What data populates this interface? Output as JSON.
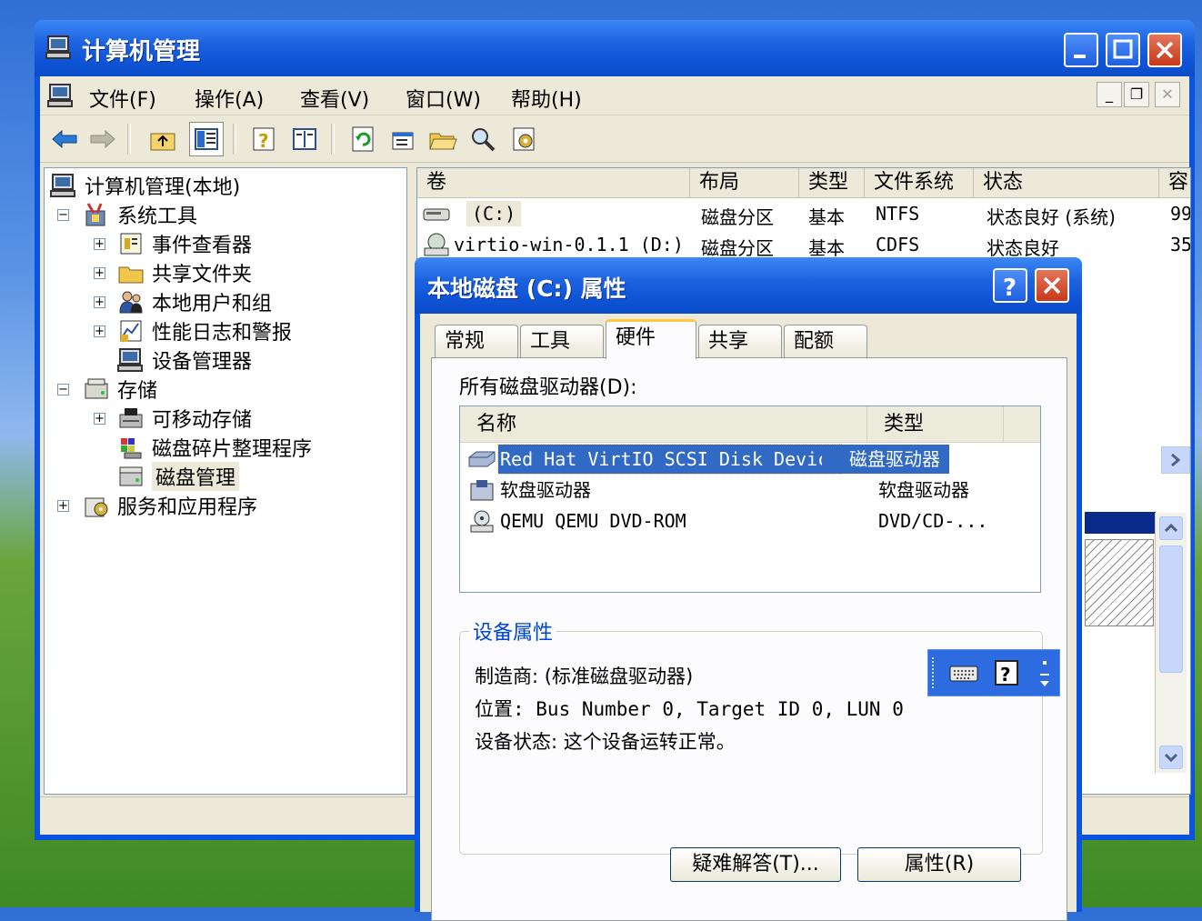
{
  "main_window": {
    "title": "计算机管理",
    "menu": [
      "文件(F)",
      "操作(A)",
      "查看(V)",
      "窗口(W)",
      "帮助(H)"
    ],
    "mdi_buttons": [
      "_",
      "❐",
      "✕"
    ]
  },
  "tree": {
    "root": "计算机管理(本地)",
    "system_tools": "系统工具",
    "event_viewer": "事件查看器",
    "shared_folders": "共享文件夹",
    "local_users": "本地用户和组",
    "perf_logs": "性能日志和警报",
    "device_manager": "设备管理器",
    "storage": "存储",
    "removable_storage": "可移动存储",
    "defrag": "磁盘碎片整理程序",
    "disk_management": "磁盘管理",
    "services_apps": "服务和应用程序"
  },
  "volume_list": {
    "columns": [
      "卷",
      "布局",
      "类型",
      "文件系统",
      "状态",
      "容"
    ],
    "rows": [
      {
        "volume": "(C:)",
        "layout": "磁盘分区",
        "type": "基本",
        "fs": "NTFS",
        "status": "状态良好 (系统)",
        "cap": "99"
      },
      {
        "volume": "virtio-win-0.1.1 (D:)",
        "layout": "磁盘分区",
        "type": "基本",
        "fs": "CDFS",
        "status": "状态良好",
        "cap": "35"
      }
    ]
  },
  "dialog": {
    "title": "本地磁盘 (C:) 属性",
    "tabs": [
      "常规",
      "工具",
      "硬件",
      "共享",
      "配额"
    ],
    "active_tab": "硬件",
    "list_label": "所有磁盘驱动器(D):",
    "list_columns": [
      "名称",
      "类型"
    ],
    "devices": [
      {
        "name": "Red Hat VirtIO SCSI Disk Device",
        "type": "磁盘驱动器"
      },
      {
        "name": "软盘驱动器",
        "type": "软盘驱动器"
      },
      {
        "name": "QEMU QEMU DVD-ROM",
        "type": "DVD/CD-..."
      }
    ],
    "group_title": "设备属性",
    "manufacturer": "制造商: (标准磁盘驱动器)",
    "location": "位置: Bus Number 0, Target ID 0, LUN 0",
    "device_status": "设备状态: 这个设备运转正常。",
    "btn_troubleshoot": "疑难解答(T)...",
    "btn_properties": "属性(R)"
  },
  "colors": {
    "titlebar": "#0a53e0",
    "selection": "#316ac5",
    "window_face": "#ece9d8",
    "group_title": "#0046d5"
  }
}
